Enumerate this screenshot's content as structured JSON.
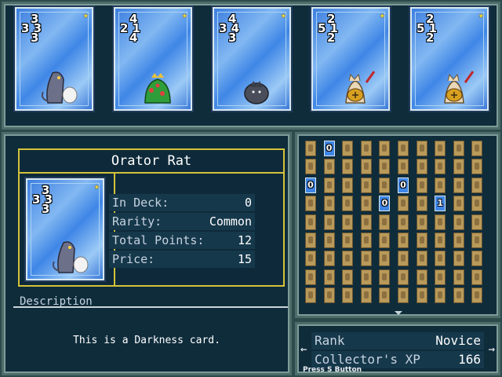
{
  "hand": [
    {
      "name": "rat-card-1",
      "top": "3",
      "mid": "3 3",
      "bottom": "3",
      "art": "rat-icon"
    },
    {
      "name": "frog-card",
      "top": "4",
      "mid": "2 1",
      "bottom": "4",
      "art": "frog-icon"
    },
    {
      "name": "blob-card",
      "top": "4",
      "mid": "3 4",
      "bottom": "3",
      "art": "blob-icon"
    },
    {
      "name": "cat-card-1",
      "top": "2",
      "mid": "5 1",
      "bottom": "2",
      "art": "cat-icon"
    },
    {
      "name": "cat-card-2",
      "top": "2",
      "mid": "5 1",
      "bottom": "2",
      "art": "cat-icon"
    }
  ],
  "detail": {
    "title": "Orator Rat",
    "card": {
      "top": "3",
      "mid": "3 3",
      "bottom": "3",
      "art": "rat-icon"
    },
    "stats": [
      {
        "label": "In Deck:",
        "value": "0"
      },
      {
        "label": "Rarity:",
        "value": "Common"
      },
      {
        "label": "Total Points:",
        "value": "12"
      },
      {
        "label": "Price:",
        "value": "15"
      }
    ],
    "description_header": "Description",
    "description": "This is a Darkness card."
  },
  "collection": {
    "columns": 10,
    "rows": 9,
    "owned": [
      {
        "row": 0,
        "col": 1,
        "count": "0"
      },
      {
        "row": 2,
        "col": 0,
        "count": "0"
      },
      {
        "row": 2,
        "col": 5,
        "count": "0"
      },
      {
        "row": 3,
        "col": 4,
        "count": "0"
      },
      {
        "row": 3,
        "col": 7,
        "count": "1"
      }
    ]
  },
  "rank": {
    "rank_label": "Rank",
    "rank_value": "Novice",
    "xp_label": "Collector's XP",
    "xp_value": "166",
    "left_arrow": "←",
    "right_arrow": "→",
    "press_hint": "Press S Button"
  },
  "colors": {
    "star": "#f3d83a",
    "card_blue": "#3f86e6",
    "panel_bg": "#0f2c3b",
    "accent_gold": "#d4c23a"
  }
}
